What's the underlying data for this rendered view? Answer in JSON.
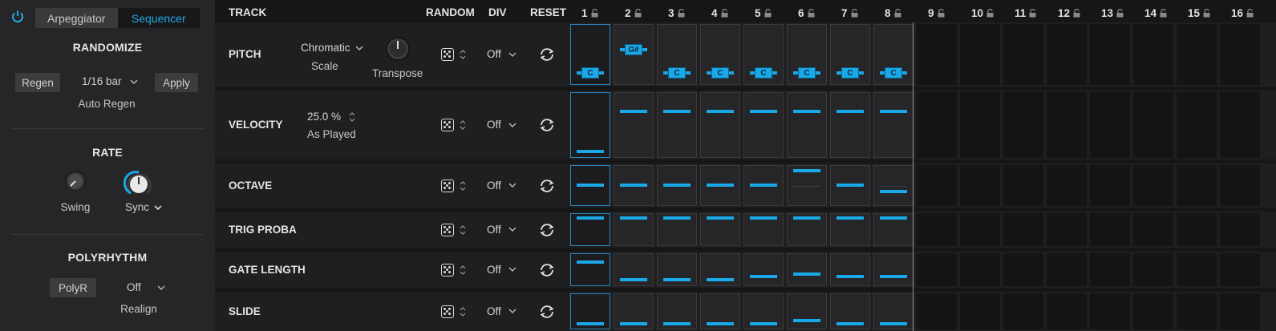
{
  "colors": {
    "accent": "#19a9e8",
    "panel": "#262628",
    "background": "#161617"
  },
  "left": {
    "power_icon": "power-icon",
    "tabs": [
      {
        "label": "Arpeggiator",
        "active": false
      },
      {
        "label": "Sequencer",
        "active": true
      }
    ],
    "randomize": {
      "title": "RANDOMIZE",
      "regen_label": "Regen",
      "bar_value": "1/16 bar",
      "apply_label": "Apply",
      "auto_regen_label": "Auto Regen"
    },
    "rate": {
      "title": "RATE",
      "swing_label": "Swing",
      "sync_label": "Sync"
    },
    "polyrhythm": {
      "title": "POLYRHYTHM",
      "polyr_label": "PolyR",
      "realign_value": "Off",
      "realign_label": "Realign"
    }
  },
  "header": {
    "track": "TRACK",
    "random": "RANDOM",
    "div": "DIV",
    "reset": "RESET",
    "steps": [
      "1",
      "2",
      "3",
      "4",
      "5",
      "6",
      "7",
      "8",
      "9",
      "10",
      "11",
      "12",
      "13",
      "14",
      "15",
      "16"
    ]
  },
  "tracks": [
    {
      "name": "PITCH",
      "scale_value": "Chromatic",
      "scale_label": "Scale",
      "transpose_label": "Transpose",
      "div": "Off"
    },
    {
      "name": "VELOCITY",
      "velocity_value": "25.0 %",
      "velocity_label": "As Played",
      "div": "Off"
    },
    {
      "name": "OCTAVE",
      "div": "Off"
    },
    {
      "name": "TRIG PROBA",
      "div": "Off"
    },
    {
      "name": "GATE LENGTH",
      "div": "Off"
    },
    {
      "name": "SLIDE",
      "div": "Off"
    }
  ],
  "pitch_notes": [
    "C",
    "G#",
    "C",
    "C",
    "C",
    "C",
    "C",
    "C"
  ],
  "active_steps": 8
}
